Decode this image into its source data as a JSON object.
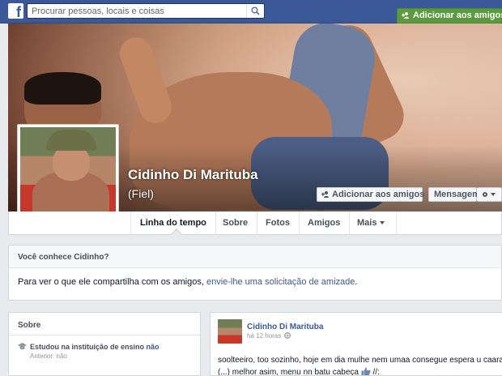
{
  "topbar": {
    "logo": "f",
    "search_placeholder": "Procurar pessoas, locais e coisas",
    "search_icon": "search-icon"
  },
  "profile": {
    "name": "Cidinho Di Marituba",
    "nickname": "(Fiel)"
  },
  "cover_actions": {
    "add_friend_label": "Adicionar aos amigos",
    "message_label": "Mensagem"
  },
  "nav": {
    "tabs": [
      {
        "label": "Linha do tempo",
        "active": true
      },
      {
        "label": "Sobre"
      },
      {
        "label": "Fotos"
      },
      {
        "label": "Amigos"
      },
      {
        "label": "Mais"
      }
    ]
  },
  "know": {
    "title": "Você conhece Cidinho?",
    "text_before": "Para ver o que ele compartilha com os amigos, ",
    "link": "envie-lhe uma solicitação de amizade",
    "text_after": ".",
    "button_label": "Adicionar aos amigos"
  },
  "about": {
    "title": "Sobre",
    "education_text": "Estudou na instituição de ensino ",
    "education_link": "não",
    "previous": "Anterior: não"
  },
  "post": {
    "author": "Cidinho Di Marituba",
    "time": "há 12 horas",
    "line1": "soolteeiro, too sozinho, hoje em dia mulhe nem umaa consegue espera u caara",
    "line2_before": "(...) melhor asim, menu nn batu cabeça ",
    "line2_after": " //:"
  },
  "colors": {
    "brand": "#3b5998",
    "green_button": "#5b9a3f",
    "page_bg": "#e9eaed"
  }
}
